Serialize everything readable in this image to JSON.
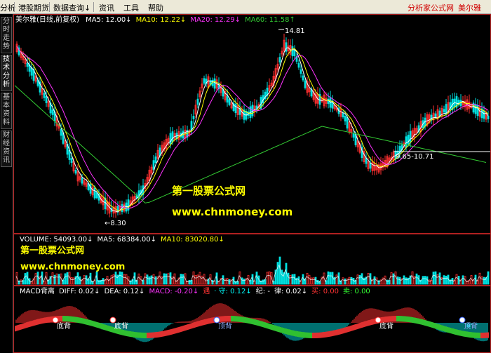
{
  "menu": {
    "items": [
      "分析",
      "港股期货",
      "数据查询",
      "资讯",
      "工具",
      "帮助"
    ],
    "arrow": "↓",
    "brand": "分析家公式网",
    "brand_stock": "美尔雅"
  },
  "sidebar": {
    "tabs": [
      "分时走势",
      "技术分析",
      "基本资料",
      "财经资讯"
    ],
    "active": 1
  },
  "price_panel": {
    "title": "美尔雅(日线,前复权)",
    "indicators": [
      {
        "label": "MA5: 12.00",
        "arrow": "↓",
        "color": "#ffffff"
      },
      {
        "label": "MA10: 12.22",
        "arrow": "↓",
        "color": "#ffff00"
      },
      {
        "label": "MA20: 12.29",
        "arrow": "↓",
        "color": "#ff33ff"
      },
      {
        "label": "MA60: 11.58",
        "arrow": "↑",
        "color": "#33cc33"
      }
    ],
    "high_label": "14.81",
    "low_label": "8.30",
    "range_label": "9.65-10.71",
    "watermark_cn": "第一股票公式网",
    "watermark_url": "www.chnmoney.com"
  },
  "volume_panel": {
    "indicators": [
      {
        "label": "VOLUME: 54093.00",
        "arrow": "↓",
        "color": "#ffffff"
      },
      {
        "label": "MA5: 68384.00",
        "arrow": "↓",
        "color": "#ffffff"
      },
      {
        "label": "MA10: 83020.80",
        "arrow": "↓",
        "color": "#ffff00"
      }
    ],
    "watermark_cn": "第一股票公式网",
    "watermark_url": "www.chnmoney.com"
  },
  "macd_panel": {
    "indicators": [
      {
        "label": "MACD背离",
        "arrow": "",
        "color": "#ffffff"
      },
      {
        "label": "DIFF: 0.02",
        "arrow": "↓",
        "color": "#ffffff"
      },
      {
        "label": "DEA: 0.12",
        "arrow": "↓",
        "color": "#ffffff"
      },
      {
        "label": "MACD: -0.20",
        "arrow": "↓",
        "color": "#ff33ff"
      },
      {
        "label": "遇",
        "arrow": "",
        "color": "#ff3333"
      },
      {
        "label": "· 守: 0.12",
        "arrow": "↓",
        "color": "#00ffff"
      },
      {
        "label": "纪: -",
        "arrow": "",
        "color": "#ffffff"
      },
      {
        "label": "律: 0.02",
        "arrow": "↓",
        "color": "#ffffff"
      },
      {
        "label": "买: 0.00",
        "arrow": "",
        "color": "#ff3333"
      },
      {
        "label": "卖: 0.00",
        "arrow": "",
        "color": "#33ff33"
      }
    ],
    "bottom_label": "底背",
    "top_label": "顶背"
  },
  "colors": {
    "up": "#ff3030",
    "down": "#00e0e0",
    "ma5": "#ffffff",
    "ma10": "#ffff00",
    "ma20": "#ff33ff",
    "ma60": "#33cc33",
    "border": "#b02020",
    "watermark": "#ffff00"
  }
}
